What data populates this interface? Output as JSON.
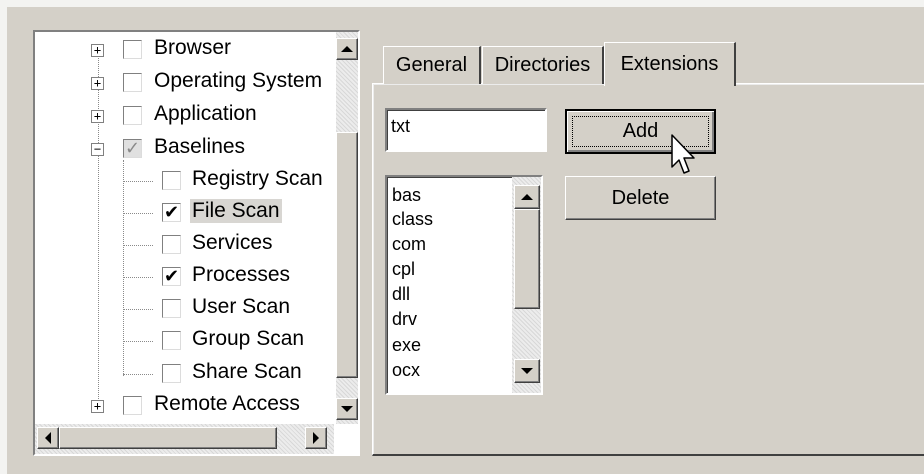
{
  "tree": {
    "items": [
      {
        "label": "Browser",
        "expander": "+",
        "checked": false
      },
      {
        "label": "Operating System",
        "expander": "+",
        "checked": false
      },
      {
        "label": "Application",
        "expander": "+",
        "checked": false
      },
      {
        "label": "Baselines",
        "expander": "−",
        "checked": true
      },
      {
        "label": "Registry Scan",
        "checked": false
      },
      {
        "label": "File Scan",
        "checked": true
      },
      {
        "label": "Services",
        "checked": false
      },
      {
        "label": "Processes",
        "checked": true
      },
      {
        "label": "User Scan",
        "checked": false
      },
      {
        "label": "Group Scan",
        "checked": false
      },
      {
        "label": "Share Scan",
        "checked": false
      },
      {
        "label": "Remote Access",
        "expander": "+",
        "checked": false
      }
    ],
    "check_mark": "✔",
    "grey_check_mark": "✓"
  },
  "tabs": [
    {
      "label": "General"
    },
    {
      "label": "Directories"
    },
    {
      "label": "Extensions"
    }
  ],
  "extension_input": {
    "value": "txt"
  },
  "buttons": {
    "add": "Add",
    "delete": "Delete"
  },
  "extensions_list": [
    "bas",
    "class",
    "com",
    "cpl",
    "dll",
    "drv",
    "exe",
    "ocx"
  ]
}
